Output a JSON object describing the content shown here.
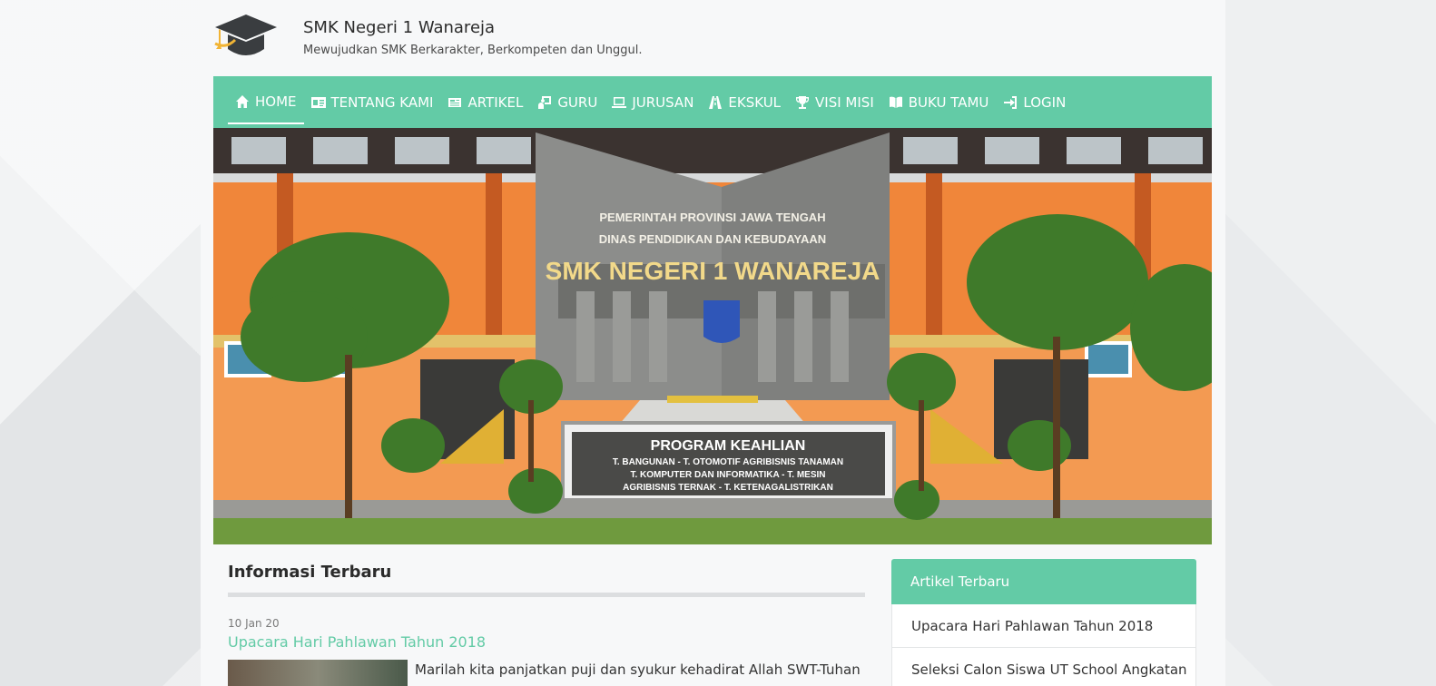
{
  "site": {
    "title": "SMK Negeri 1 Wanareja",
    "tagline": "Mewujudkan SMK Berkarakter, Berkompeten dan Unggul."
  },
  "nav": {
    "items": [
      {
        "label": "HOME",
        "icon": "home-icon",
        "active": true
      },
      {
        "label": "TENTANG KAMI",
        "icon": "id-card-icon"
      },
      {
        "label": "ARTIKEL",
        "icon": "newspaper-icon"
      },
      {
        "label": "GURU",
        "icon": "teacher-icon"
      },
      {
        "label": "JURUSAN",
        "icon": "laptop-icon"
      },
      {
        "label": "EKSKUL",
        "icon": "road-icon"
      },
      {
        "label": "VISI MISI",
        "icon": "trophy-icon"
      },
      {
        "label": "BUKU TAMU",
        "icon": "book-icon"
      },
      {
        "label": "LOGIN",
        "icon": "sign-in-icon"
      }
    ]
  },
  "hero": {
    "sign_line1": "PEMERINTAH PROVINSI JAWA TENGAH",
    "sign_line2": "DINAS PENDIDIKAN DAN KEBUDAYAAN",
    "sign_name": "SMK NEGERI 1 WANAREJA",
    "board_title": "PROGRAM KEAHLIAN",
    "board_line1": "T. BANGUNAN - T. OTOMOTIF   AGRIBISNIS TANAMAN",
    "board_line2": "T. KOMPUTER DAN INFORMATIKA - T. MESIN",
    "board_line3": "AGRIBISNIS TERNAK - T. KETENAGALISTRIKAN"
  },
  "main": {
    "section_title": "Informasi Terbaru",
    "post": {
      "date": "10 Jan 20",
      "title": "Upacara Hari Pahlawan Tahun 2018",
      "excerpt": "Marilah kita panjatkan puji dan syukur kehadirat Allah SWT-Tuhan"
    }
  },
  "sidebar": {
    "heading": "Artikel Terbaru",
    "items": [
      "Upacara Hari Pahlawan Tahun 2018",
      "Seleksi Calon Siswa UT School Angkatan"
    ]
  },
  "colors": {
    "accent": "#63cba6",
    "building_orange": "#f08a3c",
    "text_dark": "#2b2b2b"
  }
}
